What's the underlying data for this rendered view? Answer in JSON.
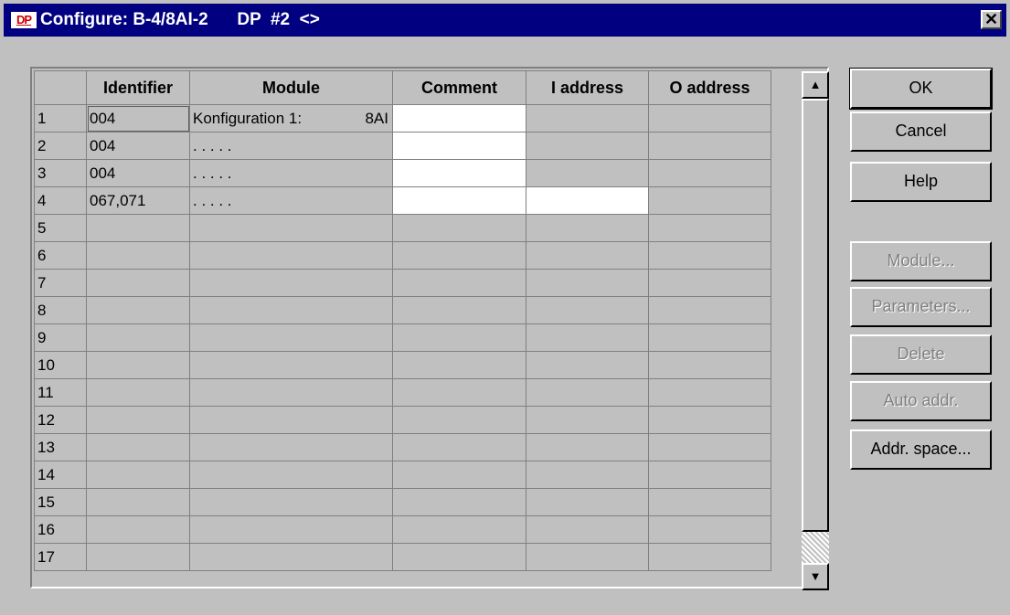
{
  "window": {
    "icon_text": "DP",
    "title": "Configure: B-4/8AI-2      DP  #2  <>",
    "close_glyph": "✕"
  },
  "grid": {
    "columns": [
      "",
      "Identifier",
      "Module",
      "Comment",
      "I address",
      "O address"
    ],
    "rows": [
      {
        "num": "1",
        "identifier": "004",
        "module_name": "Konfiguration 1:",
        "module_value": "8AI",
        "comment": "",
        "i_address": "",
        "o_address": ""
      },
      {
        "num": "2",
        "identifier": "004",
        "module_name": ". . . . .",
        "module_value": "",
        "comment": "",
        "i_address": "",
        "o_address": ""
      },
      {
        "num": "3",
        "identifier": "004",
        "module_name": ". . . . .",
        "module_value": "",
        "comment": "",
        "i_address": "",
        "o_address": ""
      },
      {
        "num": "4",
        "identifier": "067,071",
        "module_name": ". . . . .",
        "module_value": "",
        "comment": "",
        "i_address": "",
        "o_address": ""
      },
      {
        "num": "5"
      },
      {
        "num": "6"
      },
      {
        "num": "7"
      },
      {
        "num": "8"
      },
      {
        "num": "9"
      },
      {
        "num": "10"
      },
      {
        "num": "11"
      },
      {
        "num": "12"
      },
      {
        "num": "13"
      },
      {
        "num": "14"
      },
      {
        "num": "15"
      },
      {
        "num": "16"
      },
      {
        "num": "17"
      }
    ]
  },
  "scrollbar": {
    "up_glyph": "▲",
    "down_glyph": "▼"
  },
  "buttons": {
    "ok": "OK",
    "cancel": "Cancel",
    "help": "Help",
    "module": "Module...",
    "parameters": "Parameters...",
    "delete": "Delete",
    "auto_addr": "Auto addr.",
    "addr_space": "Addr. space..."
  }
}
